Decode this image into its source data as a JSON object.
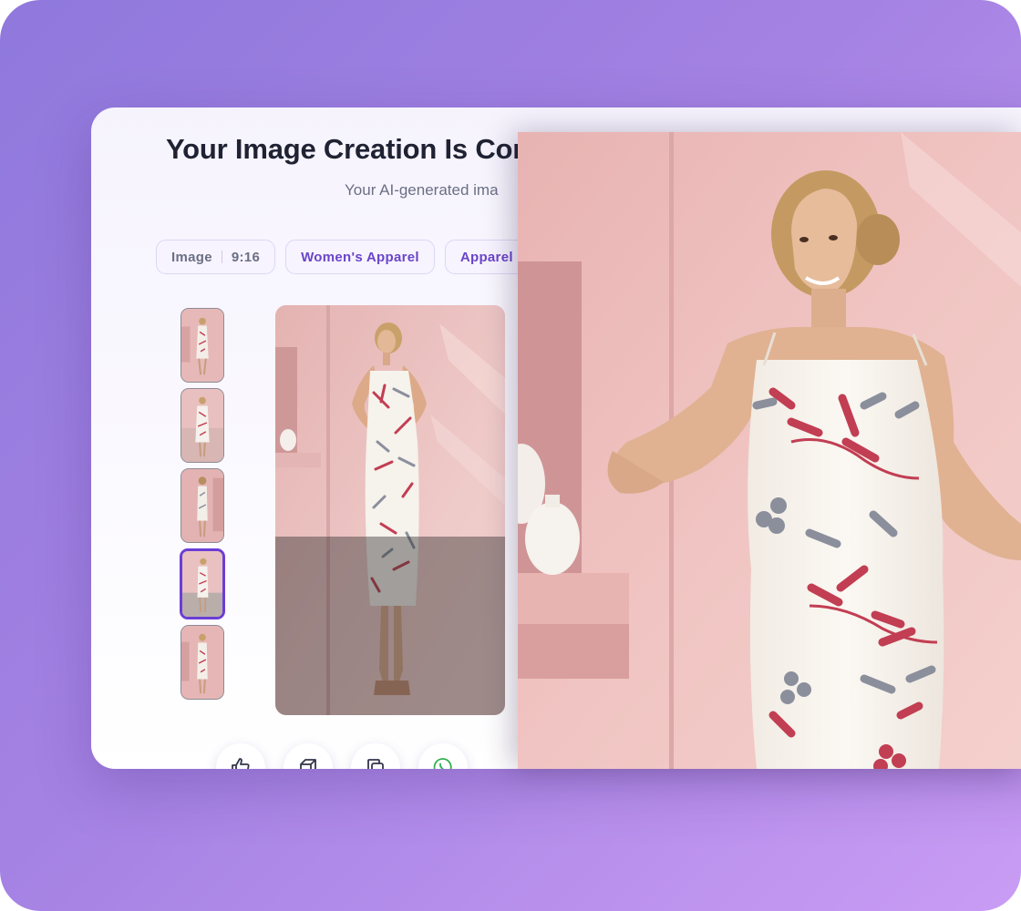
{
  "header": {
    "title": "Your Image Creation Is Cor",
    "subtitle": "Your AI-generated ima"
  },
  "chips": {
    "type": "Image",
    "ratio": "9:16",
    "category": "Women's Apparel",
    "subcategory": "Apparel"
  },
  "thumbnails": {
    "count": 5,
    "selected_index": 3
  },
  "actions": [
    {
      "icon": "thumbs-up-icon"
    },
    {
      "icon": "eraser-icon"
    },
    {
      "icon": "copy-icon"
    },
    {
      "icon": "whatsapp-icon"
    }
  ],
  "colors": {
    "accent": "#6b3ed6",
    "chip_text": "#6a45c9",
    "title": "#1f2233",
    "backdrop_start": "#8f78dc",
    "backdrop_end": "#c99cf4",
    "wall_pink": "#e9c1c0",
    "leaf_red": "#c23e52",
    "leaf_gray": "#8b8f9c"
  }
}
